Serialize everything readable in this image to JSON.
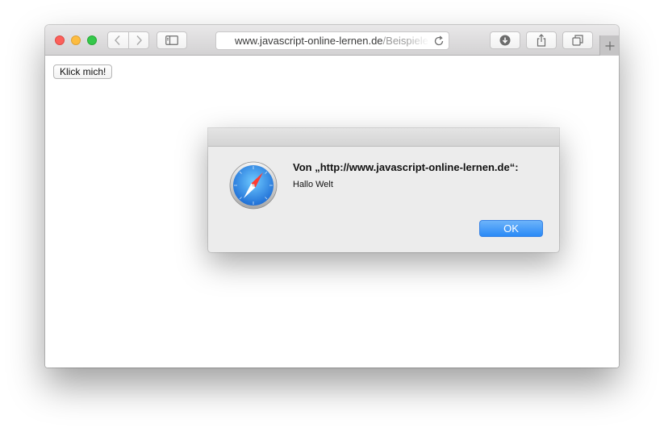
{
  "browser": {
    "url_domain": "www.javascript-online-lernen.de",
    "url_path": "/Beispiele"
  },
  "page": {
    "button_label": "Klick mich!"
  },
  "alert": {
    "title": "Von „http://www.javascript-online-lernen.de“:",
    "message": "Hallo Welt",
    "ok_label": "OK"
  },
  "icons": {
    "back": "chevron-left-icon",
    "forward": "chevron-right-icon",
    "sidebar": "sidebar-icon",
    "reload": "reload-icon",
    "download": "download-icon",
    "share": "share-icon",
    "tabs": "tabs-overview-icon",
    "new_tab": "plus-icon",
    "safari": "safari-compass-icon"
  },
  "colors": {
    "accent": "#2a8af6",
    "close": "#fc605b",
    "minimize": "#fdbc40",
    "maximize": "#34c84a"
  }
}
